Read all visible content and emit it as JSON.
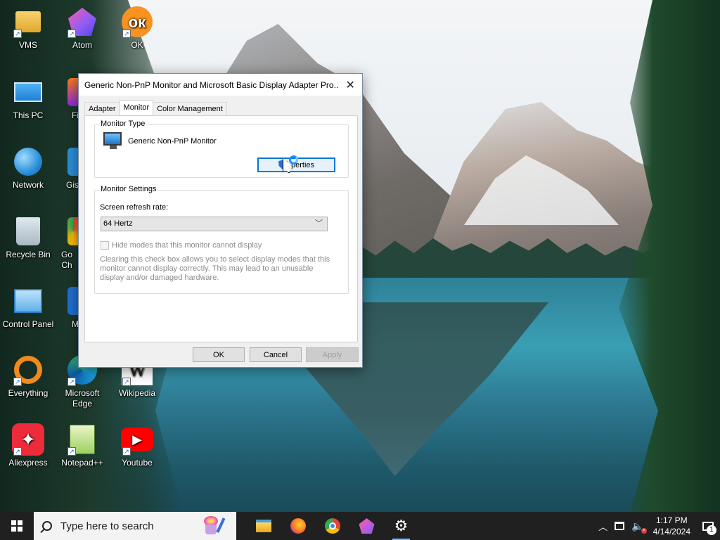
{
  "desktop": {
    "icons": [
      {
        "label": "VMS",
        "icon": "user-folder-icon"
      },
      {
        "label": "Atom",
        "icon": "atom-icon"
      },
      {
        "label": "OK",
        "icon": "ok-icon"
      },
      {
        "label": "This PC",
        "icon": "computer-icon"
      },
      {
        "label": "Fi",
        "icon": "firefox-icon"
      },
      {
        "label": "Network",
        "icon": "network-icon"
      },
      {
        "label": "Gis",
        "icon": "app-icon"
      },
      {
        "label": "Recycle Bin",
        "icon": "recycle-bin-icon"
      },
      {
        "label": "Go Ch",
        "icon": "chrome-icon"
      },
      {
        "label": "Control Panel",
        "icon": "control-panel-icon"
      },
      {
        "label": "M",
        "icon": "app-icon"
      },
      {
        "label": "Everything",
        "icon": "everything-icon"
      },
      {
        "label": "Microsoft Edge",
        "icon": "edge-icon"
      },
      {
        "label": "Wikipedia",
        "icon": "wikipedia-icon",
        "glyph": "W"
      },
      {
        "label": "Aliexpress",
        "icon": "aliexpress-icon",
        "glyph": "✦"
      },
      {
        "label": "Notepad++",
        "icon": "notepad-plus-plus-icon"
      },
      {
        "label": "Youtube",
        "icon": "youtube-icon",
        "glyph": "▶"
      }
    ],
    "ok_glyph": "ок"
  },
  "dialog": {
    "title": "Generic Non-PnP Monitor and Microsoft Basic Display Adapter Pro...",
    "close_glyph": "✕",
    "tabs": [
      {
        "label": "Adapter",
        "active": false
      },
      {
        "label": "Monitor",
        "active": true
      },
      {
        "label": "Color Management",
        "active": false
      }
    ],
    "monitor_type": {
      "group_label": "Monitor Type",
      "monitor_name": "Generic Non-PnP Monitor",
      "properties_button": "Properties",
      "properties_button_visible": "perties"
    },
    "monitor_settings": {
      "group_label": "Monitor Settings",
      "refresh_label": "Screen refresh rate:",
      "refresh_value": "64 Hertz",
      "hide_modes_label": "Hide modes that this monitor cannot display",
      "hide_modes_checked": false,
      "help_text": "Clearing this check box allows you to select display modes that this monitor cannot display correctly. This may lead to an unusable display and/or damaged hardware."
    },
    "buttons": {
      "ok": "OK",
      "cancel": "Cancel",
      "apply": "Apply"
    }
  },
  "taskbar": {
    "search_placeholder": "Type here to search",
    "apps": [
      "file-explorer-icon",
      "firefox-icon",
      "chrome-icon",
      "atom-icon",
      "settings-gear-icon"
    ],
    "clock_time": "1:17 PM",
    "clock_date": "4/14/2024",
    "notification_count": "1"
  }
}
